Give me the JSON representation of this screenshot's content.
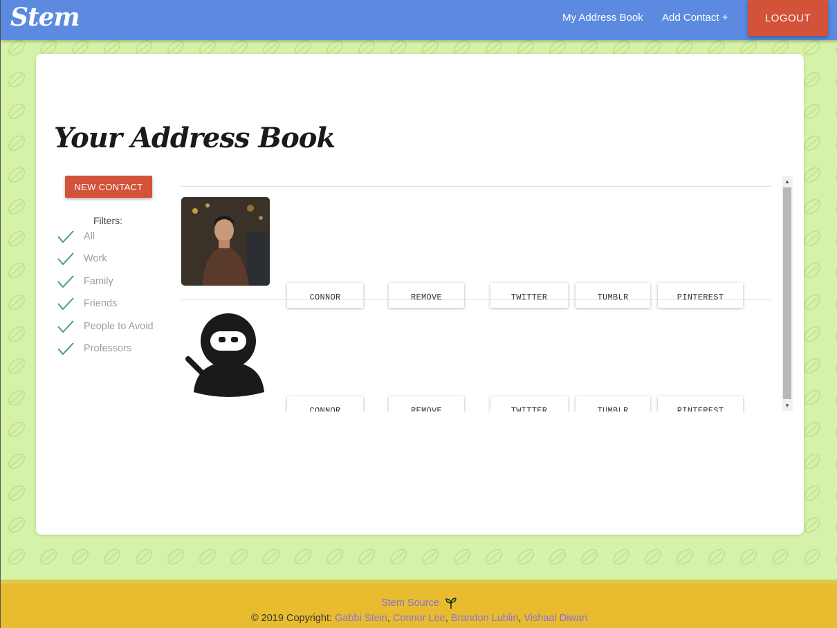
{
  "navbar": {
    "brand": "Stem",
    "links": [
      "My Address Book",
      "Add Contact +"
    ],
    "logout_label": "LOGOUT",
    "color": "#5b8ae0"
  },
  "page": {
    "title": "Your Address Book",
    "new_contact_label": "NEW CONTACT",
    "filters_label": "Filters:",
    "filters": [
      "All",
      "Work",
      "Family",
      "Friends",
      "People to Avoid",
      "Professors"
    ]
  },
  "contacts": [
    {
      "avatar": "photo-avatar",
      "buttons": [
        "CONNOR",
        "REMOVE",
        "TWITTER",
        "TUMBLR",
        "PINTEREST"
      ]
    },
    {
      "avatar": "ninja-avatar",
      "buttons": [
        "CONNOR",
        "REMOVE",
        "TWITTER",
        "TUMBLR",
        "PINTEREST"
      ]
    }
  ],
  "footer": {
    "source_label": "Stem Source",
    "copyright_prefix": "© 2019 Copyright:",
    "authors": [
      "Gabbi Stein",
      "Connor Lee",
      "Brandon Lublin",
      "Vishaal Diwan"
    ]
  },
  "colors": {
    "accent": "#d2523a",
    "background": "#d5f2a8",
    "footer": "#e8bc2e",
    "link": "#8a6fe0",
    "check": "#4a9a8a"
  }
}
